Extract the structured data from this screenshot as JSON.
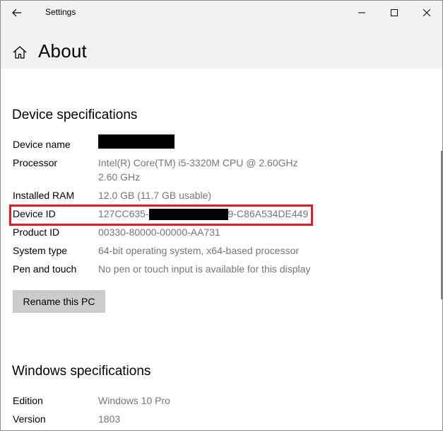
{
  "window": {
    "title": "Settings"
  },
  "header": {
    "page_title": "About"
  },
  "device_specs": {
    "heading": "Device specifications",
    "rows": [
      {
        "label": "Device name",
        "value": ""
      },
      {
        "label": "Processor",
        "value_line1": "Intel(R) Core(TM) i5-3320M CPU @ 2.60GHz",
        "value_line2": "2.60 GHz"
      },
      {
        "label": "Installed RAM",
        "value": "12.0 GB (11.7 GB usable)"
      },
      {
        "label": "Device ID",
        "value_prefix": "127CC635-",
        "value_suffix": "9-C86A534DE449"
      },
      {
        "label": "Product ID",
        "value": "00330-80000-00000-AA731"
      },
      {
        "label": "System type",
        "value": "64-bit operating system, x64-based processor"
      },
      {
        "label": "Pen and touch",
        "value": "No pen or touch input is available for this display"
      }
    ],
    "rename_button": "Rename this PC"
  },
  "windows_specs": {
    "heading": "Windows specifications",
    "rows": [
      {
        "label": "Edition",
        "value": "Windows 10 Pro"
      },
      {
        "label": "Version",
        "value": "1803"
      }
    ]
  },
  "colors": {
    "highlight": "#e01b24",
    "value_text": "#767676",
    "header_bg": "#f2f2f2",
    "button_bg": "#cccccc"
  },
  "icons": {
    "back": "back-arrow-icon",
    "home": "home-icon",
    "minimize": "minimize-icon",
    "maximize": "maximize-icon",
    "close": "close-icon"
  }
}
